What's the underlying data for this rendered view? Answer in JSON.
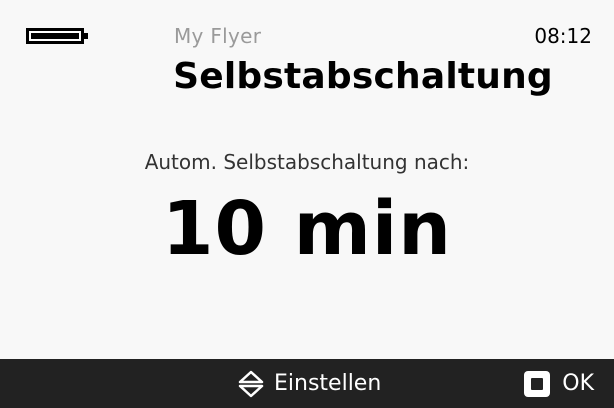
{
  "status": {
    "battery_icon": "battery-full-icon",
    "battery_level": 1.0,
    "app_name": "My Flyer",
    "time": "08:12"
  },
  "screen": {
    "title": "Selbstabschaltung",
    "prompt": "Autom. Selbstabschaltung nach:",
    "value": "10 min"
  },
  "bottom_bar": {
    "adjust_icon": "up-down-arrows-icon",
    "adjust_label": "Einstellen",
    "ok_icon": "square-button-icon",
    "ok_label": "OK"
  },
  "colors": {
    "background": "#f8f8f8",
    "bottom_bar": "#222222",
    "app_name": "#9a9a9a"
  }
}
